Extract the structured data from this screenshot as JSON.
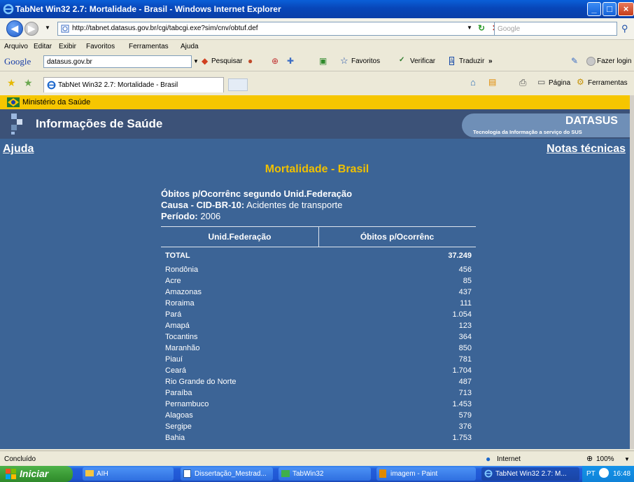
{
  "window": {
    "title": "TabNet Win32 2.7: Mortalidade - Brasil - Windows Internet Explorer"
  },
  "address": {
    "url": "http://tabnet.datasus.gov.br/cgi/tabcgi.exe?sim/cnv/obtuf.def"
  },
  "search": {
    "placeholder": "Google"
  },
  "menu": [
    "Arquivo",
    "Editar",
    "Exibir",
    "Favoritos",
    "Ferramentas",
    "Ajuda"
  ],
  "google_toolbar": {
    "logo": "Google",
    "query": "datasus.gov.br",
    "pesquisar": "Pesquisar",
    "favoritos": "Favoritos",
    "verificar": "Verificar",
    "traduzir": "Traduzir",
    "more": "»",
    "login": "Fazer login"
  },
  "tabs": {
    "active": "TabNet Win32 2.7: Mortalidade - Brasil",
    "pagina": "Página",
    "ferramentas": "Ferramentas"
  },
  "page": {
    "ministry": "Ministério da Saúde",
    "banner_title": "Informações de Saúde",
    "datasus_title": "DATASUS",
    "datasus_subtitle": "Tecnologia da Informação a serviço do SUS",
    "help_link": "Ajuda",
    "notes_link": "Notas técnicas",
    "title": "Mortalidade - Brasil",
    "heading": "Óbitos p/Ocorrênc segundo Unid.Federação",
    "cause_label": "Causa - CID-BR-10:",
    "cause_value": "Acidentes de transporte",
    "period_label": "Período:",
    "period_value": "2006"
  },
  "table": {
    "col1": "Unid.Federação",
    "col2": "Óbitos p/Ocorrênc",
    "total_label": "TOTAL",
    "total_value": "37.249",
    "rows": [
      {
        "name": "Rondônia",
        "value": "456"
      },
      {
        "name": "Acre",
        "value": "85"
      },
      {
        "name": "Amazonas",
        "value": "437"
      },
      {
        "name": "Roraima",
        "value": "111"
      },
      {
        "name": "Pará",
        "value": "1.054"
      },
      {
        "name": "Amapá",
        "value": "123"
      },
      {
        "name": "Tocantins",
        "value": "364"
      },
      {
        "name": "Maranhão",
        "value": "850"
      },
      {
        "name": "Piauí",
        "value": "781"
      },
      {
        "name": "Ceará",
        "value": "1.704"
      },
      {
        "name": "Rio Grande do Norte",
        "value": "487"
      },
      {
        "name": "Paraíba",
        "value": "713"
      },
      {
        "name": "Pernambuco",
        "value": "1.453"
      },
      {
        "name": "Alagoas",
        "value": "579"
      },
      {
        "name": "Sergipe",
        "value": "376"
      },
      {
        "name": "Bahia",
        "value": "1.753"
      }
    ]
  },
  "status": {
    "text": "Concluído",
    "zone": "Internet",
    "zoom": "100%"
  },
  "taskbar": {
    "start": "Iniciar",
    "items": [
      "AIH",
      "Dissertação_Mestrad...",
      "TabWin32",
      "imagem - Paint",
      "TabNet Win32 2.7: M..."
    ],
    "lang": "PT",
    "clock": "16:48"
  },
  "colors": {
    "content_bg": "#3c6496",
    "accent_yellow": "#f0c000",
    "ministry_bar": "#f6c600"
  }
}
